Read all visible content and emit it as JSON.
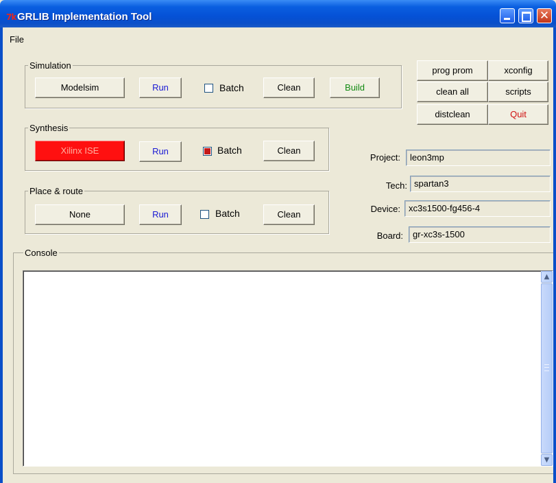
{
  "window": {
    "title": "GRLIB Implementation Tool",
    "app_icon": "tk-feather-icon",
    "controls": [
      "minimize-icon",
      "maximize-icon",
      "close-icon"
    ]
  },
  "menubar": {
    "file": "File"
  },
  "simulation": {
    "legend": "Simulation",
    "tool_button": "Modelsim",
    "run": "Run",
    "batch_label": "Batch",
    "batch_checked": false,
    "clean": "Clean",
    "build": "Build"
  },
  "synthesis": {
    "legend": "Synthesis",
    "tool_button": "Xilinx ISE",
    "run": "Run",
    "batch_label": "Batch",
    "batch_checked": true,
    "clean": "Clean"
  },
  "place_route": {
    "legend": "Place & route",
    "tool_button": "None",
    "run": "Run",
    "batch_label": "Batch",
    "batch_checked": false,
    "clean": "Clean"
  },
  "actions": {
    "prog_prom": "prog prom",
    "xconfig": "xconfig",
    "clean_all": "clean all",
    "scripts": "scripts",
    "distclean": "distclean",
    "quit": "Quit"
  },
  "info": {
    "project_label": "Project:",
    "project_value": "leon3mp",
    "tech_label": "Tech:",
    "tech_value": "spartan3",
    "device_label": "Device:",
    "device_value": "xc3s1500-fg456-4",
    "board_label": "Board:",
    "board_value": "gr-xc3s-1500"
  },
  "console": {
    "legend": "Console",
    "text": ""
  },
  "colors": {
    "titlebar": "#0a5fe0",
    "window_bg": "#ece9d8",
    "run_text": "#1a1ad4",
    "build_text": "#128a12",
    "quit_text": "#d01010",
    "xilinx_bg": "#ff1010"
  }
}
